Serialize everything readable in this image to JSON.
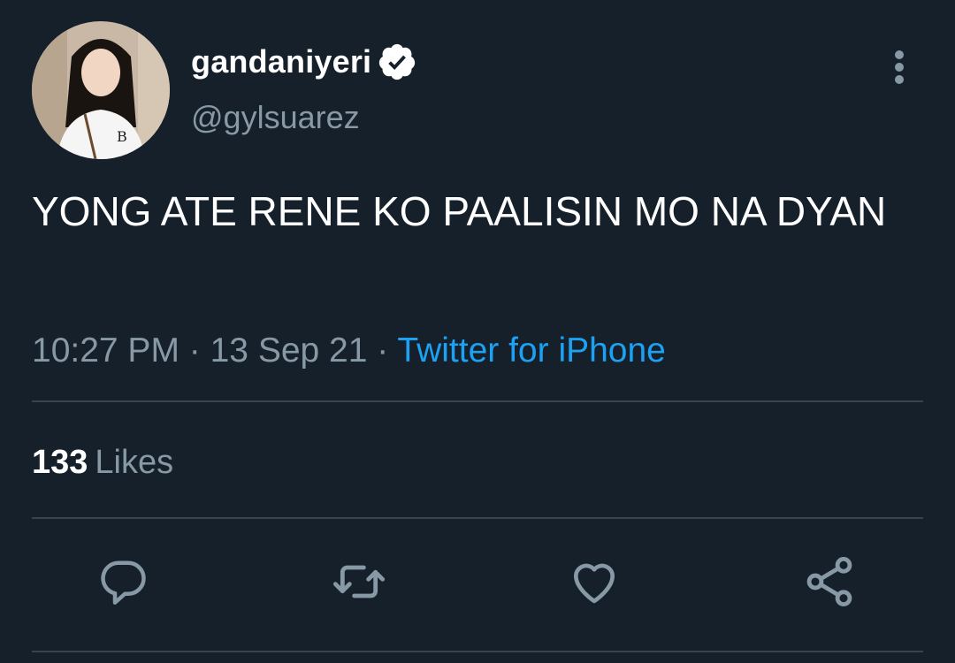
{
  "tweet": {
    "display_name": "gandaniyeri",
    "handle": "@gylsuarez",
    "text": "YONG ATE RENE KO PAALISIN MO NA DYAN",
    "time": "10:27 PM",
    "separator": " · ",
    "date": "13 Sep 21",
    "source": "Twitter for iPhone"
  },
  "stats": {
    "likes_count": "133",
    "likes_label": "Likes"
  },
  "icons": {
    "verified": "verified-badge-icon",
    "more": "more-vertical-icon",
    "reply": "reply-icon",
    "retweet": "retweet-icon",
    "like": "heart-icon",
    "share": "share-icon"
  },
  "colors": {
    "background": "#15202b",
    "text": "#ffffff",
    "muted": "#8899a6",
    "link": "#1da1f2",
    "divider": "#38444d"
  }
}
